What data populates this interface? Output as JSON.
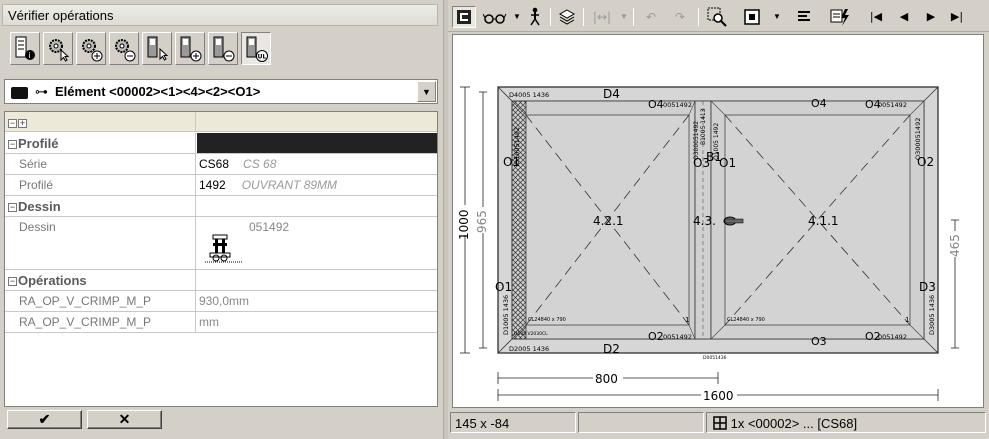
{
  "left_panel": {
    "title": "Vérifier opérations",
    "tool_icons": [
      "info-tool-icon",
      "gear-cursor-tool-icon",
      "gear-add-tool-icon",
      "gear-remove-tool-icon",
      "profile-cursor-tool-icon",
      "profile-add-tool-icon",
      "profile-remove-tool-icon",
      "profile-ul-tool-icon"
    ],
    "element_selector": {
      "value": "Elément <00002><1><4><2><O1>"
    },
    "grid": {
      "header_expand": "−",
      "header_collapse": "+",
      "rows": [
        {
          "type": "category",
          "label": "Profilé",
          "toggle": "−"
        },
        {
          "type": "property",
          "label": "Série",
          "value": "CS68",
          "secondary": "CS 68"
        },
        {
          "type": "property",
          "label": "Profilé",
          "value": "1492",
          "secondary": "OUVRANT 89MM"
        },
        {
          "type": "category",
          "label": "Dessin",
          "toggle": "−"
        },
        {
          "type": "property",
          "label": "Dessin",
          "value": "051492"
        },
        {
          "type": "category",
          "label": "Opérations",
          "toggle": "−"
        },
        {
          "type": "property",
          "label": "RA_OP_V_CRIMP_M_P",
          "value": "930,0mm"
        },
        {
          "type": "property",
          "label": "RA_OP_V_CRIMP_M_P",
          "value": "mm"
        }
      ]
    },
    "ok_label": "✔",
    "cancel_label": "✕"
  },
  "right_panel": {
    "toolbar": [
      "frame-icon",
      "glasses-icon",
      "person-icon",
      "layers-icon",
      "fit-width-icon",
      "undo-icon",
      "redo-icon",
      "zoom-region-icon",
      "frame-toggle-icon",
      "align-icon",
      "lightning-icon",
      "first-icon",
      "prev-icon",
      "next-icon",
      "last-icon"
    ],
    "status": {
      "coords": "145 x -84",
      "selection": "1x <00002> ... [CS68]"
    }
  },
  "drawing": {
    "colors": {
      "fill": "#d3d3d3",
      "line": "#222222"
    },
    "dim_total_height": "1000",
    "dim_inner_height": "965",
    "dim_right_height": "465",
    "dim_half_width": "800",
    "dim_total_width": "1600",
    "profile_top_left": "D4005 1436",
    "label_top_center": "D4",
    "label_bottom_center": "D2",
    "profile_bottom_left": "D2005 1436",
    "profile_bottom_center": "D0051436",
    "label_O4_left": "O4",
    "label_O4_right": "O4",
    "label_O4_far": "O4",
    "profile_O4_left": "0051492",
    "profile_O4_far": "0051492",
    "label_O1_left": "O1",
    "label_O2_right": "O2",
    "label_O3_left": "O3",
    "label_O1_mid": "O1",
    "label_B1": "B1",
    "label_O1_bottom_left": "O1",
    "label_D3": "D3",
    "label_O2_bottom_left": "O2",
    "label_O3_bottom": "O3",
    "label_O2_bottom_right": "O2",
    "profile_O2_bottom_left": "0051492",
    "profile_O2_bottom_right": "0051492",
    "sash_left_label": "4.2.1",
    "sash_mid_label": "4.3.",
    "sash_right_label": "4.1.1",
    "glazing_left": "CL24840 x 790",
    "glazing_right": "CL24840 x 790",
    "num_1_left": "1",
    "num_1_right": "1",
    "bottom_left_small": "D105 V2030CL",
    "vert_profile_left": "D1005 1436",
    "vert_profile_right": "D3005 1436",
    "vert_sash_left": "O10051492",
    "vert_sash_mid_a": "O300051492",
    "vert_sash_mid_b": "O1005 1492",
    "vert_sash_right": "O300051492",
    "vert_mullion": "B1005 1413"
  }
}
